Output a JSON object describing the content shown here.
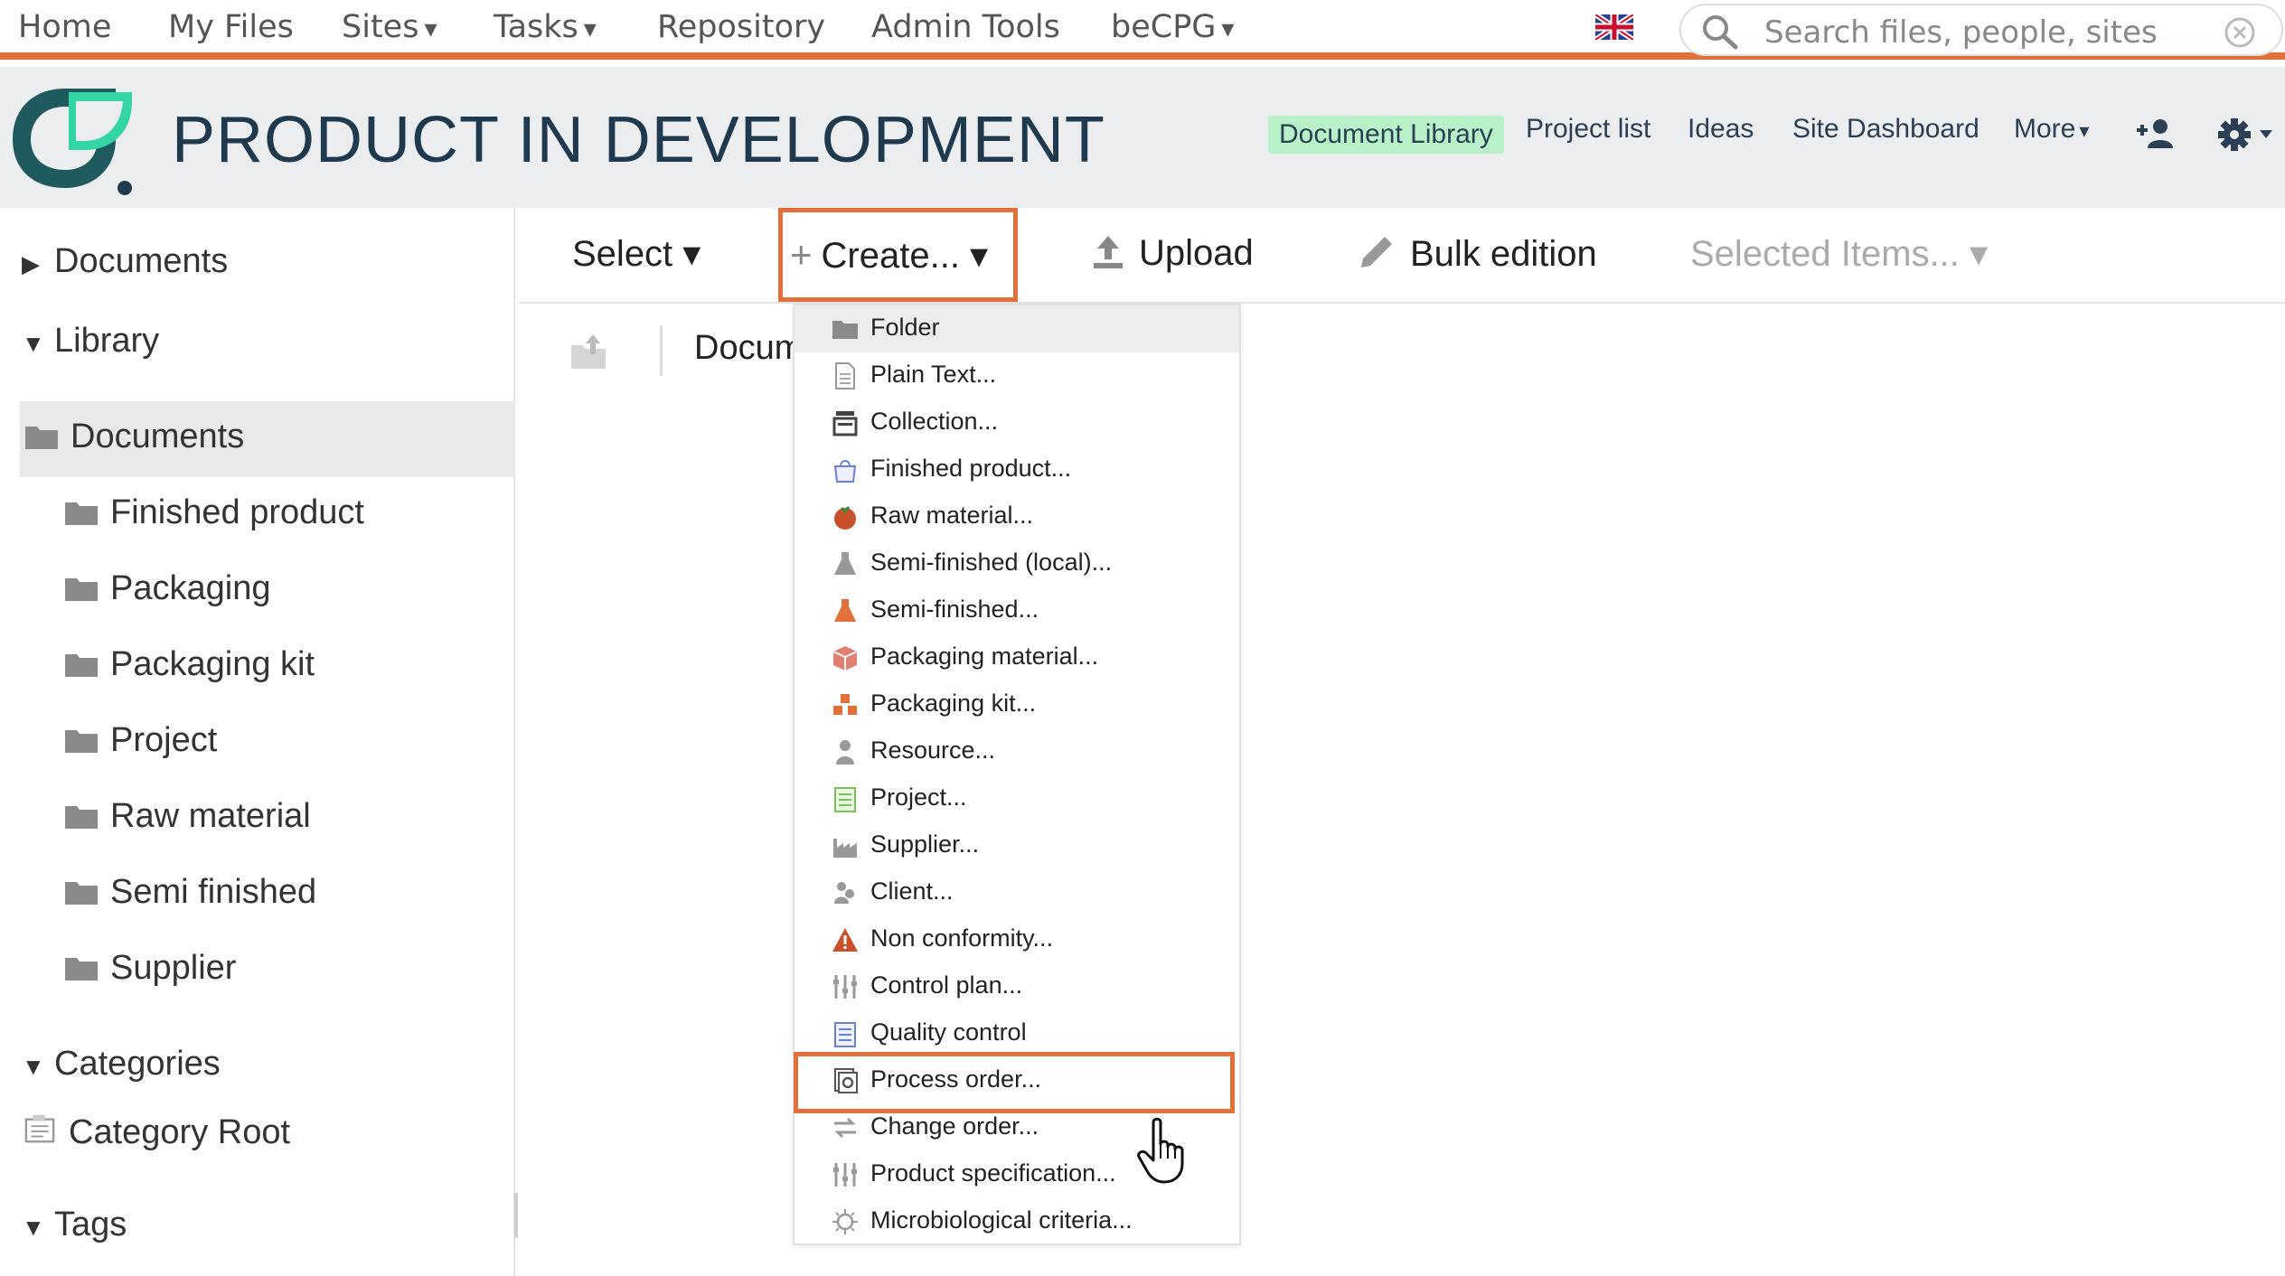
{
  "topnav": {
    "items": [
      {
        "label": "Home",
        "caret": ""
      },
      {
        "label": "My Files",
        "caret": ""
      },
      {
        "label": "Sites",
        "caret": "▾"
      },
      {
        "label": "Tasks",
        "caret": "▾"
      },
      {
        "label": "Repository",
        "caret": ""
      },
      {
        "label": "Admin Tools",
        "caret": ""
      },
      {
        "label": "beCPG",
        "caret": "▾"
      }
    ],
    "search_placeholder": "Search files, people, sites"
  },
  "site": {
    "title": "PRODUCT IN DEVELOPMENT",
    "nav": [
      {
        "label": "Document Library"
      },
      {
        "label": "Project list"
      },
      {
        "label": "Ideas"
      },
      {
        "label": "Site Dashboard"
      },
      {
        "label": "More",
        "caret": "▾"
      }
    ]
  },
  "tree": {
    "documents": "Documents",
    "library": "Library",
    "library_root": "Documents",
    "folders": [
      "Finished product",
      "Packaging",
      "Packaging kit",
      "Project",
      "Raw material",
      "Semi finished",
      "Supplier"
    ],
    "categories": "Categories",
    "category_root": "Category Root",
    "tags": "Tags"
  },
  "toolbar": {
    "select": "Select ▾",
    "create": "Create... ▾",
    "upload": "Upload",
    "bulk": "Bulk edition",
    "selected": "Selected Items... ▾",
    "path": "Documents"
  },
  "menu": {
    "items": [
      {
        "label": "Folder",
        "icon": "folder-icon"
      },
      {
        "label": "Plain Text...",
        "icon": "text-file-icon"
      },
      {
        "label": "Collection...",
        "icon": "collection-icon"
      },
      {
        "label": "Finished product...",
        "icon": "finished-product-icon"
      },
      {
        "label": "Raw material...",
        "icon": "raw-material-icon"
      },
      {
        "label": "Semi-finished (local)...",
        "icon": "flask-grey-icon"
      },
      {
        "label": "Semi-finished...",
        "icon": "flask-orange-icon"
      },
      {
        "label": "Packaging material...",
        "icon": "box-icon"
      },
      {
        "label": "Packaging kit...",
        "icon": "packaging-kit-icon"
      },
      {
        "label": "Resource...",
        "icon": "resource-icon"
      },
      {
        "label": "Project...",
        "icon": "project-icon"
      },
      {
        "label": "Supplier...",
        "icon": "factory-icon"
      },
      {
        "label": "Client...",
        "icon": "client-icon"
      },
      {
        "label": "Non conformity...",
        "icon": "warning-icon"
      },
      {
        "label": "Control plan...",
        "icon": "sliders-icon"
      },
      {
        "label": "Quality control",
        "icon": "checklist-icon"
      },
      {
        "label": "Process order...",
        "icon": "process-order-icon"
      },
      {
        "label": "Change order...",
        "icon": "swap-arrows-icon"
      },
      {
        "label": "Product specification...",
        "icon": "sliders-icon"
      },
      {
        "label": "Microbiological criteria...",
        "icon": "microbe-icon"
      }
    ]
  },
  "colors": {
    "accent": "#e2703a",
    "active_nav": "#b8f0c8",
    "title": "#1f3a4f"
  }
}
